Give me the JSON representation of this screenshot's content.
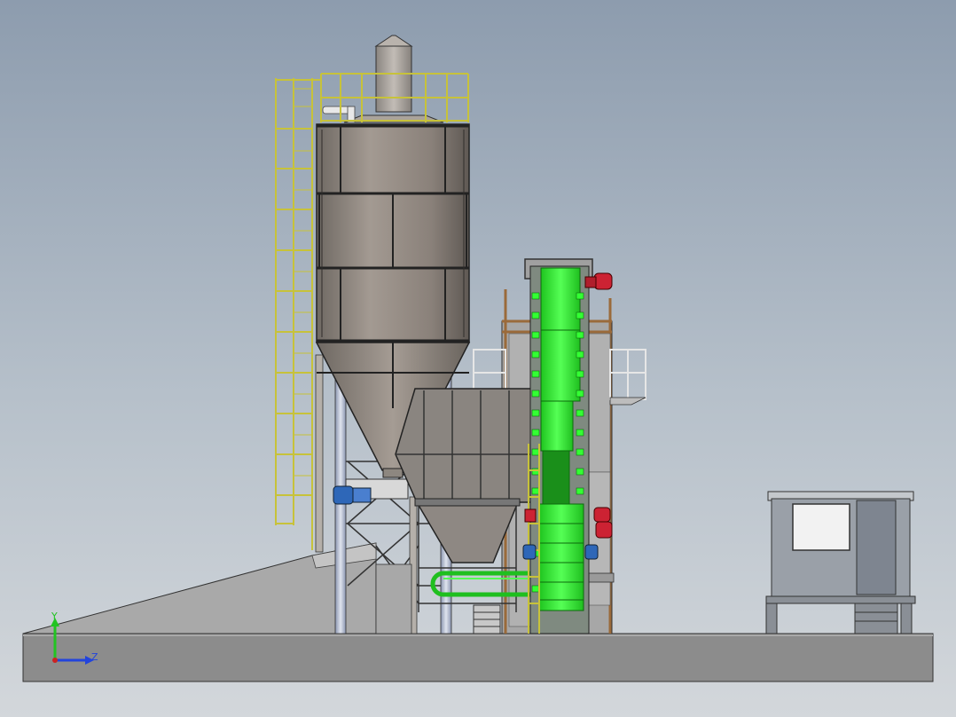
{
  "viewport": {
    "background_top": "#8d9cae",
    "background_bottom": "#d3d7db"
  },
  "triad": {
    "y_label": "Y",
    "z_label": "Z",
    "y_color": "#22c422",
    "z_color": "#2244dd",
    "x_color": "#cc2222"
  },
  "colors": {
    "ground": "#8c8c8c",
    "silo": "#8a817a",
    "silo_seam": "#2b2b2b",
    "ladder": "#c7c23a",
    "conveyor": "#33ff33",
    "motor_red": "#cc2233",
    "motor_blue": "#2e67b8",
    "frame": "#9a6a3a",
    "cabin": "#9aa0a8",
    "cabin_dark": "#7e8590"
  },
  "components": [
    "silo",
    "silo-vent",
    "silo-ladder",
    "roof-railing",
    "support-legs",
    "ramp",
    "hopper",
    "bucket-elevator",
    "tower-frame",
    "belt-conveyor",
    "control-cabin"
  ]
}
